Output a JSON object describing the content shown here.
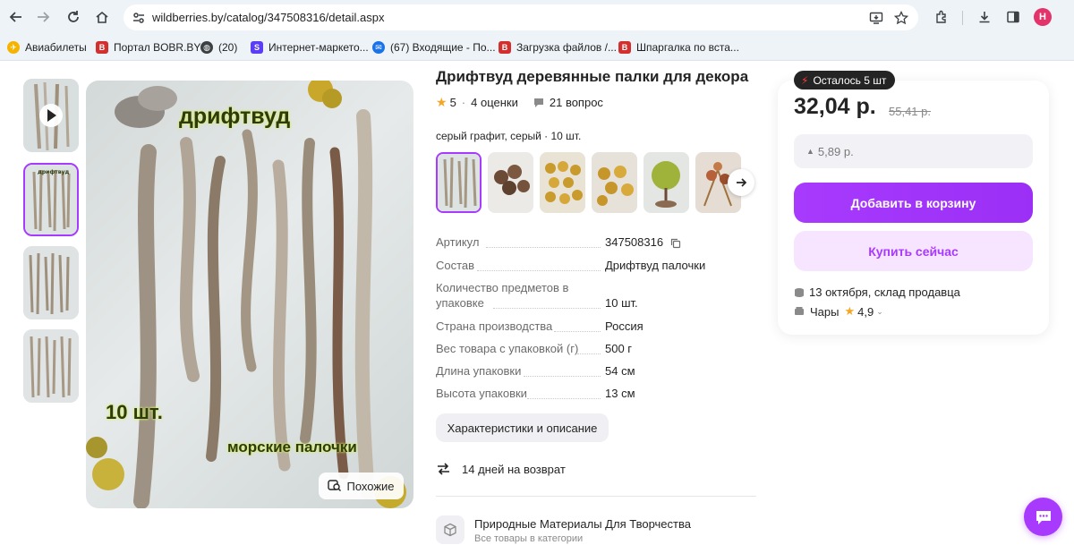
{
  "browser": {
    "url": "wildberries.by/catalog/347508316/detail.aspx",
    "profile_initial": "Н",
    "bookmarks": [
      {
        "label": "Авиабилеты",
        "icon": "globe-colored-icon",
        "color": "#e37400"
      },
      {
        "label": "Портал BOBR.BY",
        "icon": "bobr-favicon",
        "color": "#d32f2f"
      },
      {
        "label": "(20)",
        "icon": "globe-icon",
        "color": "#3c4043"
      },
      {
        "label": "Интернет-маркето...",
        "icon": "s-favicon",
        "color": "#5b3df5"
      },
      {
        "label": "(67) Входящие - По...",
        "icon": "mail-favicon",
        "color": "#1a73e8"
      },
      {
        "label": "Загрузка файлов /...",
        "icon": "bobr-favicon",
        "color": "#d32f2f"
      },
      {
        "label": "Шпаргалка по вста...",
        "icon": "bobr-favicon",
        "color": "#d32f2f"
      }
    ]
  },
  "product": {
    "title": "Дрифтвуд деревянные палки для декора",
    "rating": "5",
    "reviews": "4 оценки",
    "questions": "21 вопрос",
    "color_line": "серый графит, серый · 10 шт.",
    "photo_text_main": "дрифтвуд",
    "photo_text_count": "10 шт.",
    "photo_text_bottom": "морские палочки",
    "similar_label": "Похожие",
    "specs": [
      {
        "key": "Артикул",
        "value": "347508316"
      },
      {
        "key": "Состав",
        "value": "Дрифтвуд палочки"
      },
      {
        "key": "Количество предметов в упаковке",
        "value": "10 шт."
      },
      {
        "key": "Страна производства",
        "value": "Россия"
      },
      {
        "key": "Вес товара с упаковкой (г)",
        "value": "500 г"
      },
      {
        "key": "Длина упаковки",
        "value": "54 см"
      },
      {
        "key": "Высота упаковки",
        "value": "13 см"
      }
    ],
    "chars_button": "Характеристики и описание",
    "return_policy": "14 дней на возврат",
    "category_title": "Природные Материалы Для Творчества",
    "category_sub": "Все товары в категории"
  },
  "buy": {
    "stock_badge": "Осталось 5 шт",
    "price": "32,04 р.",
    "old_price": "55,41 р.",
    "price_change": "5,89 р.",
    "add_to_cart": "Добавить в корзину",
    "buy_now": "Купить сейчас",
    "delivery_date": "13 октября",
    "delivery_from": ", склад продавца",
    "seller": "Чары",
    "seller_rating": "4,9"
  },
  "colors": {
    "accent": "#a73afd",
    "accent_light": "#f7e4fe",
    "star": "#f5a623"
  }
}
